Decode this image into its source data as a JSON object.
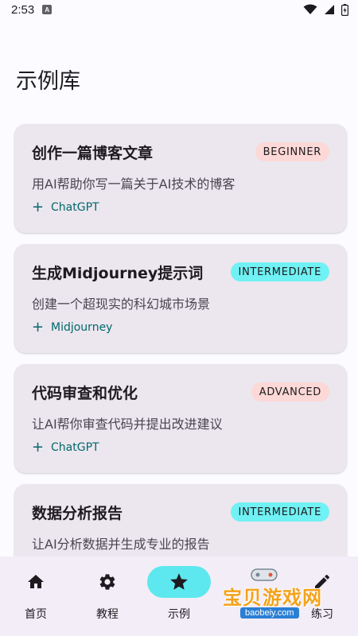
{
  "status": {
    "time": "2:53",
    "app_icon_letter": "A"
  },
  "page": {
    "title": "示例库"
  },
  "examples": [
    {
      "title": "创作一篇博客文章",
      "badge": "BEGINNER",
      "badge_color": "#fcd8d6",
      "description": "用AI帮助你写一篇关于AI技术的博客",
      "tag": "ChatGPT"
    },
    {
      "title": "生成Midjourney提示词",
      "badge": "INTERMEDIATE",
      "badge_color": "#70f1f3",
      "description": "创建一个超现实的科幻城市场景",
      "tag": "Midjourney"
    },
    {
      "title": "代码审查和优化",
      "badge": "ADVANCED",
      "badge_color": "#fcd8d6",
      "description": "让AI帮你审查代码并提出改进建议",
      "tag": "ChatGPT"
    },
    {
      "title": "数据分析报告",
      "badge": "INTERMEDIATE",
      "badge_color": "#70f1f3",
      "description": "让AI分析数据并生成专业的报告",
      "tag": ""
    }
  ],
  "nav": {
    "items": [
      {
        "label": "首页",
        "icon": "home-icon"
      },
      {
        "label": "教程",
        "icon": "gear-icon"
      },
      {
        "label": "示例",
        "icon": "star-icon",
        "active": true
      },
      {
        "label": "",
        "icon": ""
      },
      {
        "label": "练习",
        "icon": "pencil-icon"
      }
    ]
  },
  "watermark": {
    "text": "宝贝游戏网",
    "url": "baobeiy.com"
  },
  "colors": {
    "accent": "#5ce8ee",
    "tag_text": "#00696c",
    "card_bg": "#ece6ee",
    "nav_bg": "#f3edf7"
  }
}
